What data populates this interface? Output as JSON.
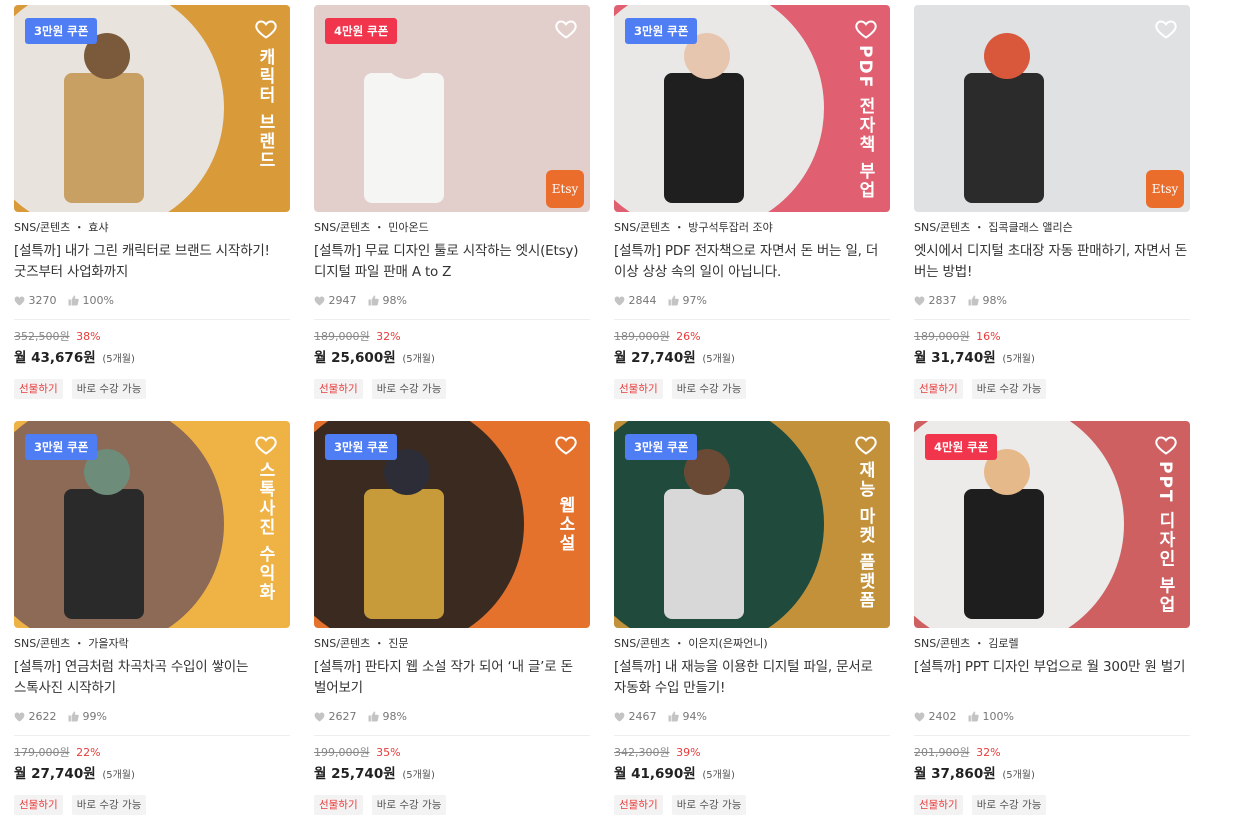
{
  "courses": [
    {
      "coupon": "3만원 쿠폰",
      "coupon_color": "#4f7df3",
      "bg": "#d99a3a",
      "circle": "#e8e3dc",
      "s1": "#c8a064",
      "s2": "#7a5a3a",
      "vtitle": "캐릭터 브랜드",
      "etsy": "",
      "meta": "SNS/콘텐츠 ・ 효샤",
      "title": "[설특까] 내가 그린 캐릭터로 브랜드 시작하기! 굿즈부터 사업화까지",
      "likes": "3270",
      "rating": "100%",
      "orig": "352,500원",
      "discount": "38%",
      "monthly": "월 43,676원",
      "months": "(5개월)",
      "tag_gift": "선물하기",
      "tag_now": "바로 수강 가능"
    },
    {
      "coupon": "4만원 쿠폰",
      "coupon_color": "#f0354c",
      "bg": "#e2cfcb",
      "circle": "#e2cfcb",
      "s1": "#f5f5f3",
      "s2": "#e2cfcb",
      "vtitle": "",
      "etsy": "Etsy",
      "meta": "SNS/콘텐츠 ・ 민아온드",
      "title": "[설특까] 무료 디자인 툴로 시작하는 엣시(Etsy) 디지털 파일 판매 A to Z",
      "likes": "2947",
      "rating": "98%",
      "orig": "189,000원",
      "discount": "32%",
      "monthly": "월 25,600원",
      "months": "(5개월)",
      "tag_gift": "선물하기",
      "tag_now": "바로 수강 가능"
    },
    {
      "coupon": "3만원 쿠폰",
      "coupon_color": "#4f7df3",
      "bg": "#e05f70",
      "circle": "#e9e8e6",
      "s1": "#1f1f1f",
      "s2": "#e7c6b0",
      "vtitle": "PDF 전자책 부업",
      "etsy": "",
      "meta": "SNS/콘텐츠 ・ 방구석투잡러 조야",
      "title": "[설특까] PDF 전자책으로 자면서 돈 버는 일, 더 이상 상상 속의 일이 아닙니다.",
      "likes": "2844",
      "rating": "97%",
      "orig": "189,000원",
      "discount": "26%",
      "monthly": "월 27,740원",
      "months": "(5개월)",
      "tag_gift": "선물하기",
      "tag_now": "바로 수강 가능"
    },
    {
      "coupon": "",
      "coupon_color": "",
      "bg": "#dfe1e3",
      "circle": "#dfe1e3",
      "s1": "#2b2b2b",
      "s2": "#d9573b",
      "vtitle": "",
      "etsy": "Etsy",
      "meta": "SNS/콘텐츠 ・ 집콕클래스 앨리슨",
      "title": "엣시에서 디지털 초대장 자동 판매하기, 자면서 돈 버는 방법!",
      "likes": "2837",
      "rating": "98%",
      "orig": "189,000원",
      "discount": "16%",
      "monthly": "월 31,740원",
      "months": "(5개월)",
      "tag_gift": "선물하기",
      "tag_now": "바로 수강 가능"
    },
    {
      "coupon": "3만원 쿠폰",
      "coupon_color": "#4f7df3",
      "bg": "#efb244",
      "circle": "#8c6a55",
      "s1": "#2a2a2a",
      "s2": "#6d8c7a",
      "vtitle": "스톡사진 수익화",
      "etsy": "",
      "meta": "SNS/콘텐츠 ・ 가을자락",
      "title": "[설특까] 연금처럼 차곡차곡 수입이 쌓이는 스톡사진 시작하기",
      "likes": "2622",
      "rating": "99%",
      "orig": "179,000원",
      "discount": "22%",
      "monthly": "월 27,740원",
      "months": "(5개월)",
      "tag_gift": "선물하기",
      "tag_now": "바로 수강 가능"
    },
    {
      "coupon": "3만원 쿠폰",
      "coupon_color": "#4f7df3",
      "bg": "#e4712c",
      "circle": "#3a2a20",
      "s1": "#c79a3a",
      "s2": "#2d2d38",
      "vtitle": "웹소설",
      "etsy": "",
      "meta": "SNS/콘텐츠 ・ 진문",
      "title": "[설특까] 판타지 웹 소설 작가 되어 ‘내 글’로 돈 벌어보기",
      "likes": "2627",
      "rating": "98%",
      "orig": "199,000원",
      "discount": "35%",
      "monthly": "월 25,740원",
      "months": "(5개월)",
      "tag_gift": "선물하기",
      "tag_now": "바로 수강 가능"
    },
    {
      "coupon": "3만원 쿠폰",
      "coupon_color": "#4f7df3",
      "bg": "#c3913a",
      "circle": "#1f4a3c",
      "s1": "#d8d8d8",
      "s2": "#6b4a35",
      "vtitle": "재능 마켓 플랫폼",
      "etsy": "",
      "meta": "SNS/콘텐츠 ・ 이은지(은짜언니)",
      "title": "[설특까] 내 재능을 이용한 디지털 파일, 문서로 자동화 수입 만들기!",
      "likes": "2467",
      "rating": "94%",
      "orig": "342,300원",
      "discount": "39%",
      "monthly": "월 41,690원",
      "months": "(5개월)",
      "tag_gift": "선물하기",
      "tag_now": "바로 수강 가능"
    },
    {
      "coupon": "4만원 쿠폰",
      "coupon_color": "#f0354c",
      "bg": "#cf6062",
      "circle": "#ecebea",
      "s1": "#1e1e1e",
      "s2": "#e6b98a",
      "vtitle": "PPT 디자인 부업",
      "etsy": "",
      "meta": "SNS/콘텐츠 ・ 김로렐",
      "title": "[설특까] PPT 디자인 부업으로 월 300만 원 벌기",
      "likes": "2402",
      "rating": "100%",
      "orig": "201,900원",
      "discount": "32%",
      "monthly": "월 37,860원",
      "months": "(5개월)",
      "tag_gift": "선물하기",
      "tag_now": "바로 수강 가능"
    }
  ]
}
